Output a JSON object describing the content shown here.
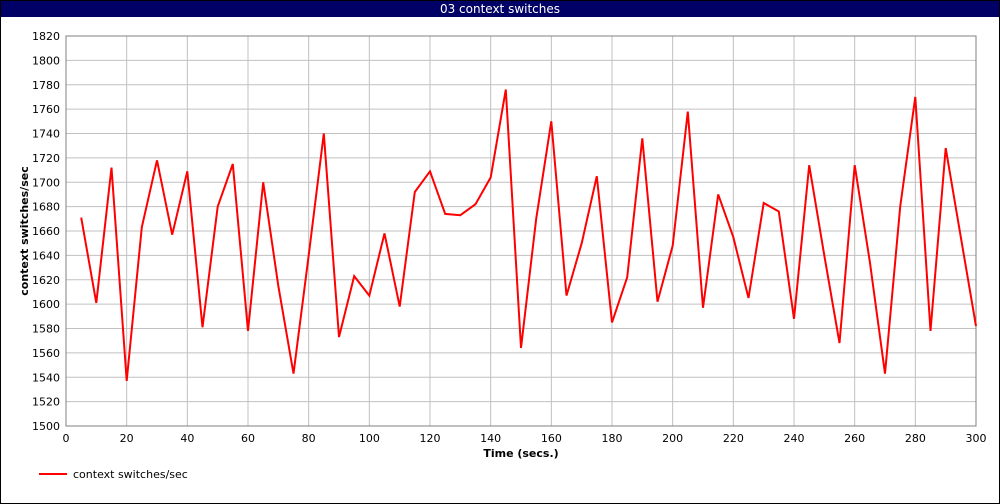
{
  "window": {
    "title": "03 context switches"
  },
  "colors": {
    "series": "#ff0000",
    "grid": "#c0c0c0",
    "titlebar": "#000066"
  },
  "chart_data": {
    "type": "line",
    "xlabel": "Time (secs.)",
    "ylabel": "context switches/sec",
    "xlim": [
      0,
      300
    ],
    "ylim": [
      1500,
      1820
    ],
    "xticks": [
      0,
      20,
      40,
      60,
      80,
      100,
      120,
      140,
      160,
      180,
      200,
      220,
      240,
      260,
      280,
      300
    ],
    "yticks": [
      1500,
      1520,
      1540,
      1560,
      1580,
      1600,
      1620,
      1640,
      1660,
      1680,
      1700,
      1720,
      1740,
      1760,
      1780,
      1800,
      1820
    ],
    "grid": true,
    "legend_position": "bottom-left",
    "series": [
      {
        "name": "context switches/sec",
        "x": [
          5,
          10,
          15,
          20,
          25,
          30,
          35,
          40,
          45,
          50,
          55,
          60,
          65,
          70,
          75,
          80,
          85,
          90,
          95,
          100,
          105,
          110,
          115,
          120,
          125,
          130,
          135,
          140,
          145,
          150,
          155,
          160,
          165,
          170,
          175,
          180,
          185,
          190,
          195,
          200,
          205,
          210,
          215,
          220,
          225,
          230,
          235,
          240,
          245,
          250,
          255,
          260,
          265,
          270,
          275,
          280,
          285,
          290,
          295,
          300
        ],
        "y": [
          1671,
          1601,
          1712,
          1537,
          1663,
          1718,
          1657,
          1709,
          1581,
          1680,
          1715,
          1578,
          1700,
          1615,
          1543,
          1640,
          1740,
          1573,
          1623,
          1607,
          1658,
          1598,
          1692,
          1709,
          1674,
          1673,
          1682,
          1704,
          1776,
          1564,
          1670,
          1750,
          1607,
          1650,
          1705,
          1585,
          1622,
          1736,
          1602,
          1648,
          1758,
          1597,
          1690,
          1655,
          1605,
          1683,
          1676,
          1588,
          1714,
          1640,
          1568,
          1714,
          1635,
          1543,
          1680,
          1770,
          1578,
          1728,
          1655,
          1582
        ]
      }
    ]
  }
}
